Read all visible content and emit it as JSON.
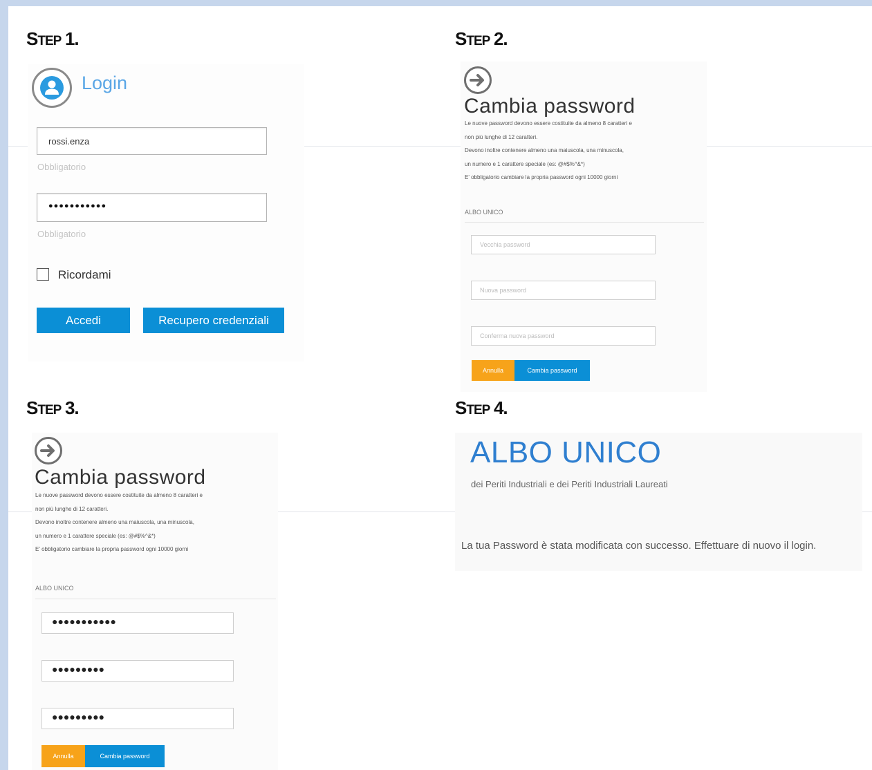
{
  "steps": {
    "s1": {
      "title_s": "S",
      "title_tep": "TEP",
      "title_num": "1."
    },
    "s2": {
      "title_s": "S",
      "title_tep": "TEP",
      "title_num": "2."
    },
    "s3": {
      "title_s": "S",
      "title_tep": "TEP",
      "title_num": "3."
    },
    "s4": {
      "title_s": "S",
      "title_tep": "TEP",
      "title_num": "4."
    }
  },
  "login": {
    "title": "Login",
    "username_value": "rossi.enza",
    "username_hint": "Obbligatorio",
    "password_value": "●●●●●●●●●●●",
    "password_hint": "Obbligatorio",
    "remember_label": "Ricordami",
    "access_button": "Accedi",
    "recover_button": "Recupero credenziali"
  },
  "change_password": {
    "title": "Cambia password",
    "info_lines": [
      "Le nuove password devono essere costituite da almeno 8 caratteri e",
      "non più lunghe di 12 caratteri.",
      "Devono inoltre contenere almeno una maiuscola, una minuscola,",
      "un numero e 1 carattere speciale (es: @#$%^&*)",
      "E' obbligatorio cambiare la propria password ogni 10000 giorni"
    ],
    "section_label": "ALBO UNICO",
    "old_password_placeholder": "Vecchia password",
    "new_password_placeholder": "Nuova password",
    "confirm_password_placeholder": "Conferma nuova password",
    "cancel_button": "Annulla",
    "submit_button": "Cambia password"
  },
  "change_password_filled": {
    "old_password_value": "●●●●●●●●●●●",
    "new_password_value": "●●●●●●●●●",
    "confirm_password_value": "●●●●●●●●●"
  },
  "albo": {
    "title": "ALBO UNICO",
    "subtitle": "dei Periti Industriali e dei Periti Industriali Laureati",
    "success_message": "La tua Password è stata modificata con successo. Effettuare di nuovo il login."
  },
  "colors": {
    "primary_blue": "#0b8fd6",
    "cancel_orange": "#f7a31a",
    "albo_blue": "#2f7fd0",
    "login_title": "#5aa6e6"
  }
}
